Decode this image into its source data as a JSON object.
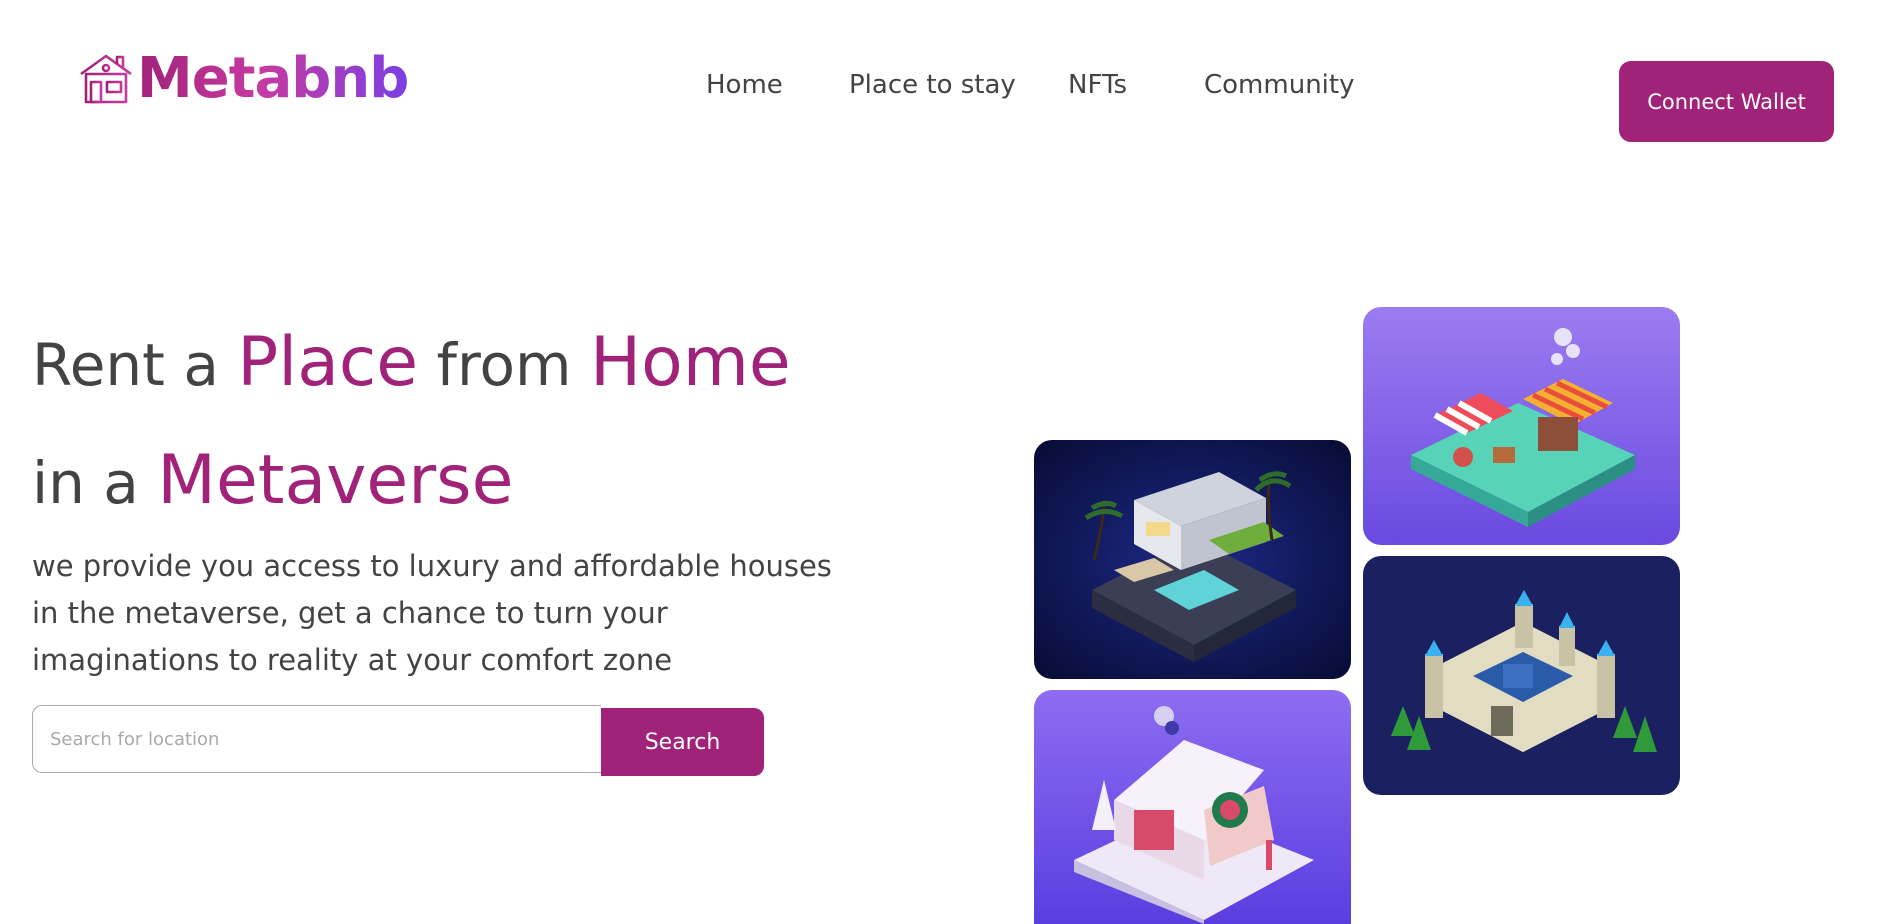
{
  "header": {
    "brand": "Metabnb",
    "nav": [
      "Home",
      "Place to stay",
      "NFTs",
      "Community"
    ],
    "connect_label": "Connect Wallet"
  },
  "hero": {
    "headline": {
      "rent": "Rent a ",
      "place": "Place",
      "from": " from ",
      "home": "Home",
      "in_a": "in a ",
      "metaverse": "Metaverse"
    },
    "description": "we provide you access to luxury and affordable houses in the metaverse, get a chance to turn your imaginations to reality at your comfort zone",
    "search": {
      "placeholder": "Search for location",
      "value": "",
      "button_label": "Search"
    }
  },
  "gallery": [
    {
      "icon": "modern-villa-image"
    },
    {
      "icon": "market-stall-image"
    },
    {
      "icon": "castle-image"
    },
    {
      "icon": "snow-cottage-image"
    }
  ],
  "colors": {
    "accent": "#a02279",
    "text": "#434343",
    "logo_gradient": [
      "#a02279",
      "#7b3fe4"
    ],
    "placeholder": "#a9a9a9"
  }
}
